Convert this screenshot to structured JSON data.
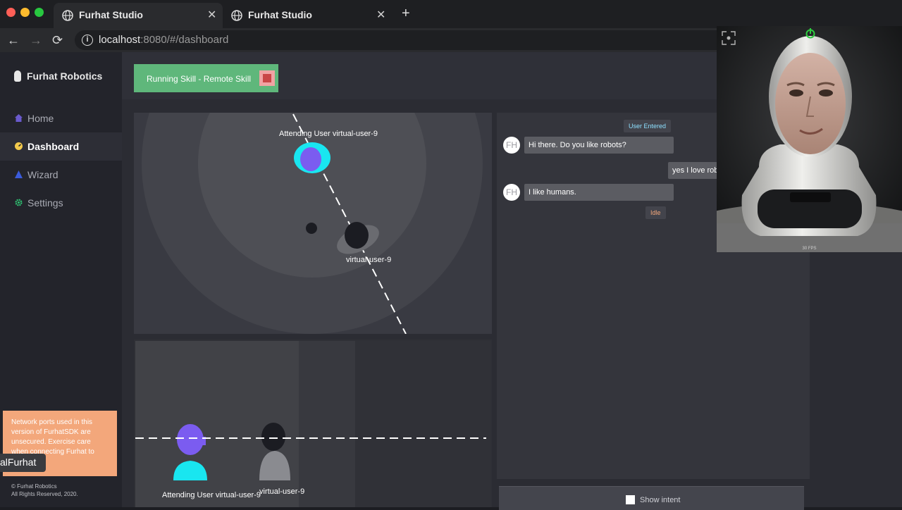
{
  "browser": {
    "tabs": [
      {
        "title": "Furhat Studio",
        "close": "✕"
      },
      {
        "title": "Furhat Studio",
        "close": "✕"
      }
    ],
    "new_tab": "+",
    "back": "←",
    "forward": "→",
    "reload": "⟳",
    "url_host": "localhost",
    "url_rest": ":8080/#/dashboard",
    "info_icon": "i"
  },
  "sidebar": {
    "brand": "Furhat Robotics",
    "items": [
      {
        "label": "Home",
        "icon": "home-icon",
        "color": "#6a5acd"
      },
      {
        "label": "Dashboard",
        "icon": "dashboard-icon",
        "color": "#f2c94c"
      },
      {
        "label": "Wizard",
        "icon": "wizard-icon",
        "color": "#3b5bdb"
      },
      {
        "label": "Settings",
        "icon": "gear-icon",
        "color": "#2fbf71"
      }
    ],
    "notice": "Network ports used in this version of FurhatSDK are unsecured. Exercise care when connecting Furhat to networks",
    "tooltip": "alFurhat",
    "copyright_line1": "© Furhat Robotics",
    "copyright_line2": "All Rights Reserved, 2020."
  },
  "skill": {
    "label": "Running Skill - Remote Skill"
  },
  "top_view": {
    "attending_label": "Attending User virtual-user-9",
    "user_label": "virtual-user-9"
  },
  "side_view": {
    "attending_label": "Attending User virtual-user-9",
    "user_label": "virtual-user-9"
  },
  "chat": {
    "user_entered": "User Entered",
    "avatar_text": "FH",
    "messages": [
      {
        "from": "robot",
        "text": "Hi there. Do you like robots?"
      },
      {
        "from": "user",
        "text": "yes I love robots"
      },
      {
        "from": "robot",
        "text": "I like humans."
      }
    ],
    "idle": "Idle"
  },
  "robot_view": {
    "fps": "30 FPS"
  },
  "show_intent": {
    "label": "Show intent"
  },
  "colors": {
    "running_green": "#5fb77b",
    "attending_cyan": "#19e6f0",
    "attending_purple": "#7b5cf0",
    "notice_orange": "#f3a77b",
    "power_green": "#2ecc40"
  }
}
